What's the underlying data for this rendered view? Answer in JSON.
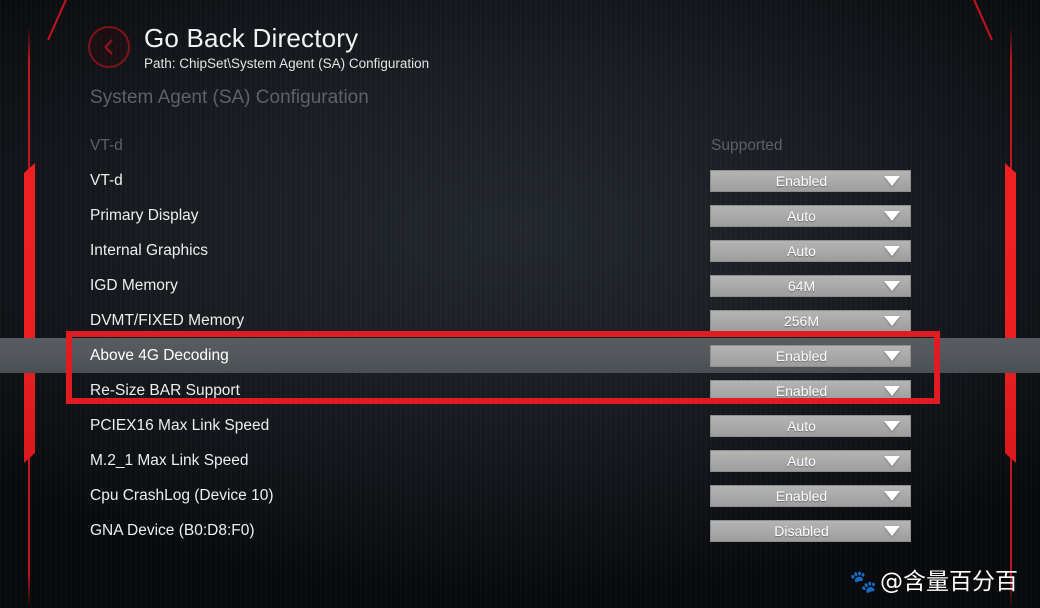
{
  "header": {
    "back_icon": "chevron-left-circle-icon",
    "title": "Go Back Directory",
    "breadcrumb": "Path: ChipSet\\System Agent (SA) Configuration"
  },
  "section": {
    "heading": "System Agent (SA) Configuration"
  },
  "colors": {
    "accent_red": "#e01b22",
    "edge_red": "#ee2024",
    "background": "#1a1e23",
    "dropdown_gray": "#a9a9a9",
    "selected_row": "#53585c",
    "muted_text": "#5d6268"
  },
  "rows": [
    {
      "label": "VT-d",
      "type": "static",
      "value": "Supported",
      "muted": true,
      "selected": false
    },
    {
      "label": "VT-d",
      "type": "dropdown",
      "value": "Enabled",
      "muted": false,
      "selected": false
    },
    {
      "label": "Primary Display",
      "type": "dropdown",
      "value": "Auto",
      "muted": false,
      "selected": false
    },
    {
      "label": "Internal Graphics",
      "type": "dropdown",
      "value": "Auto",
      "muted": false,
      "selected": false
    },
    {
      "label": "IGD Memory",
      "type": "dropdown",
      "value": "64M",
      "muted": false,
      "selected": false
    },
    {
      "label": "DVMT/FIXED Memory",
      "type": "dropdown",
      "value": "256M",
      "muted": false,
      "selected": false
    },
    {
      "label": "Above 4G Decoding",
      "type": "dropdown",
      "value": "Enabled",
      "muted": false,
      "selected": true
    },
    {
      "label": "Re-Size BAR Support",
      "type": "dropdown",
      "value": "Enabled",
      "muted": false,
      "selected": false
    },
    {
      "label": "PCIEX16 Max Link Speed",
      "type": "dropdown",
      "value": "Auto",
      "muted": false,
      "selected": false
    },
    {
      "label": "M.2_1 Max Link Speed",
      "type": "dropdown",
      "value": "Auto",
      "muted": false,
      "selected": false
    },
    {
      "label": "Cpu CrashLog (Device 10)",
      "type": "dropdown",
      "value": "Enabled",
      "muted": false,
      "selected": false
    },
    {
      "label": "GNA Device (B0:D8:F0)",
      "type": "dropdown",
      "value": "Disabled",
      "muted": false,
      "selected": false
    }
  ],
  "annotation": {
    "name": "red-highlight-box",
    "highlighted_rows": [
      "Above 4G Decoding",
      "Re-Size BAR Support"
    ]
  },
  "watermark": {
    "paw_icon": "baidu-paw-icon",
    "text": "@含量百分百"
  }
}
